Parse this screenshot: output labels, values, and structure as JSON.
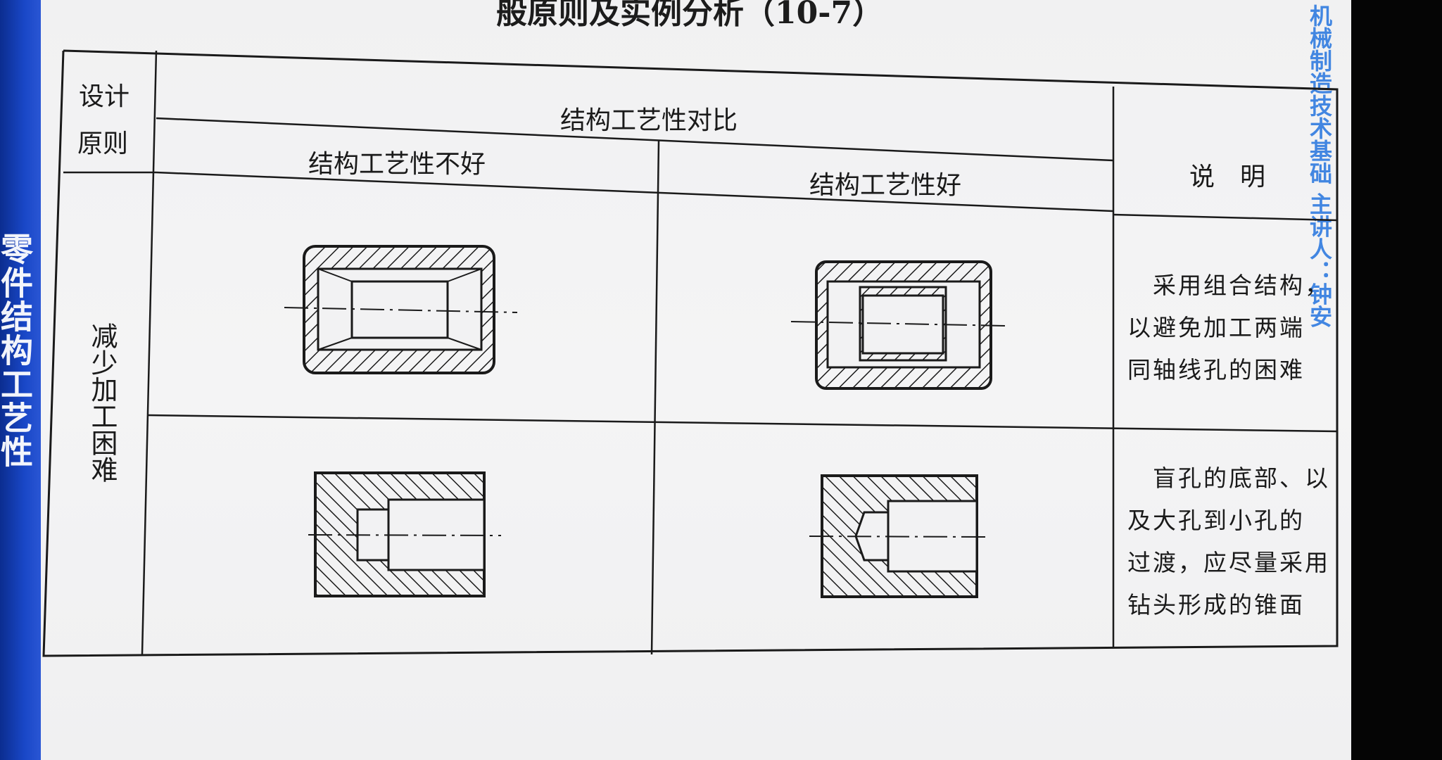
{
  "slide": {
    "title": "般原则及实例分析（10-7）",
    "side_label": "零件结构工艺性",
    "watermark": "机械制造技术基础 主讲人：钟安"
  },
  "table": {
    "header_principle": "设计原则",
    "header_principle_line1": "设计",
    "header_principle_line2": "原则",
    "header_compare": "结构工艺性对比",
    "header_bad": "结构工艺性不好",
    "header_good": "结构工艺性好",
    "header_note": "说　明",
    "principle": "减少加工困难",
    "rows": [
      {
        "note_lines": [
          "　采用组合结构，",
          "以避免加工两端",
          "同轴线孔的困难"
        ]
      },
      {
        "note_lines": [
          "　盲孔的底部、以",
          "及大孔到小孔的",
          "过渡，应尽量采用",
          "钻头形成的锥面"
        ]
      }
    ]
  },
  "colors": {
    "accent_blue": "#1947c7",
    "watermark_blue": "#2f7be0",
    "ink": "#1a1a1a"
  }
}
